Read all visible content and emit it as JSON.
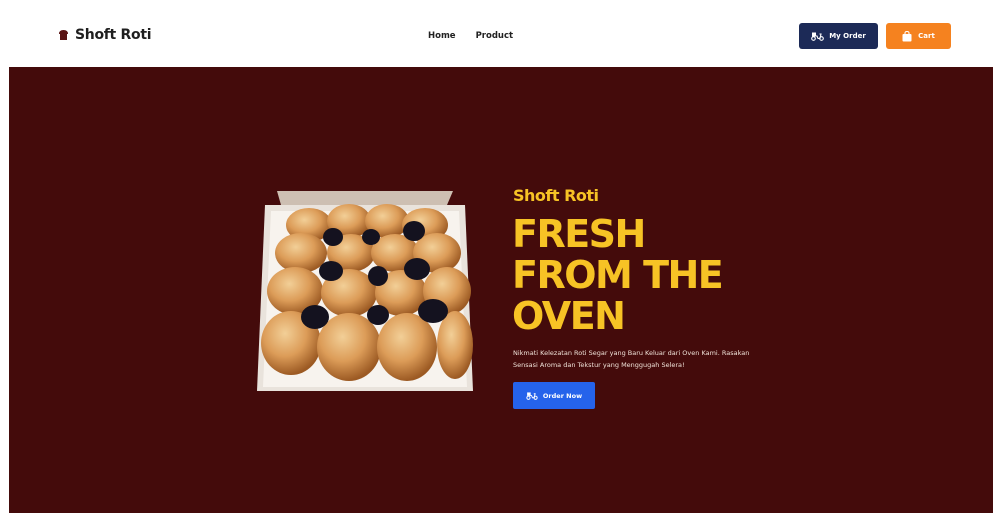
{
  "header": {
    "brand": "Shoft Roti",
    "nav": [
      "Home",
      "Product"
    ],
    "my_order_label": "My Order",
    "cart_label": "Cart"
  },
  "hero": {
    "subtitle": "Shoft Roti",
    "title_lines": [
      "FRESH",
      "FROM THE",
      "OVEN"
    ],
    "description": "Nikmati Kelezatan Roti Segar yang Baru Keluar dari Oven Kami. Rasakan Sensasi Aroma dan Tekstur yang Menggugah Selera!",
    "order_now_label": "Order Now"
  },
  "colors": {
    "hero_bg": "#440b0b",
    "accent_yellow": "#f7c325",
    "my_order_bg": "#1c2a57",
    "cart_bg": "#f5821f",
    "order_now_bg": "#2563eb"
  },
  "icons": {
    "brand": "bread-icon",
    "my_order": "delivery-scooter-icon",
    "cart": "shopping-bag-icon",
    "order_now": "delivery-scooter-icon"
  }
}
